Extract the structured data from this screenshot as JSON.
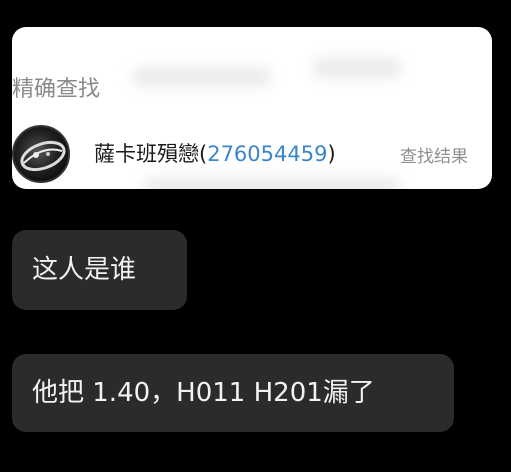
{
  "screenshot_card": {
    "title": "精确查找",
    "result": {
      "name": "薩卡班殞戀",
      "open_paren": "(",
      "qq_number": "276054459",
      "close_paren": ")",
      "tag": "查找结果"
    }
  },
  "messages": [
    {
      "text": "这人是谁"
    },
    {
      "text": "他把 1.40，H011 H201漏了"
    }
  ],
  "colors": {
    "background": "#000000",
    "bubble": "#2b2b2b",
    "qq_number": "#3a86c8"
  }
}
